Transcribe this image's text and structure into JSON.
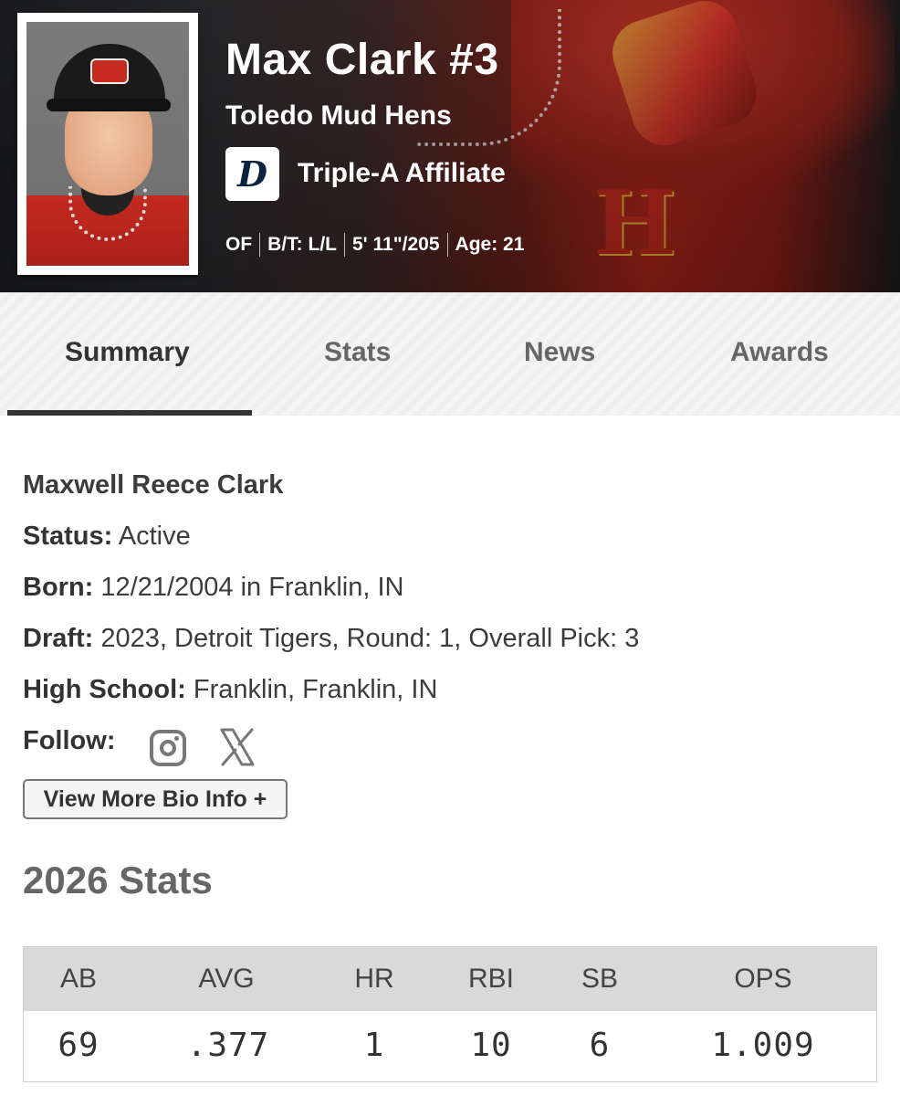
{
  "header": {
    "player_name": "Max Clark #3",
    "team": "Toledo Mud Hens",
    "affiliate_logo_letter": "D",
    "affiliate": "Triple-A Affiliate",
    "meta": [
      "OF",
      "B/T: L/L",
      "5' 11\"/205",
      "Age: 21"
    ]
  },
  "tabs": [
    {
      "label": "Summary",
      "active": true
    },
    {
      "label": "Stats",
      "active": false
    },
    {
      "label": "News",
      "active": false
    },
    {
      "label": "Awards",
      "active": false
    }
  ],
  "bio": {
    "full_name": "Maxwell Reece Clark",
    "status_label": "Status:",
    "status_value": " Active",
    "born_label": "Born:",
    "born_value": " 12/21/2004 in Franklin, IN",
    "draft_label": "Draft:",
    "draft_value": " 2023, Detroit Tigers, Round: 1, Overall Pick: 3",
    "hs_label": "High School:",
    "hs_value": " Franklin, Franklin, IN",
    "follow_label": "Follow:",
    "social_icons": [
      "instagram-icon",
      "x-icon"
    ],
    "more_button": "View More Bio Info +"
  },
  "stats": {
    "title": "2026 Stats",
    "headers": [
      "AB",
      "AVG",
      "HR",
      "RBI",
      "SB",
      "OPS"
    ],
    "values": [
      "69",
      ".377",
      "1",
      "10",
      "6",
      "1.009"
    ]
  },
  "colors": {
    "accent_dark": "#333333",
    "tab_bg": "#f4f4f4",
    "table_head_bg": "#d9d9d9",
    "hero_red": "#b1261c",
    "tigers_navy": "#0c2340"
  }
}
